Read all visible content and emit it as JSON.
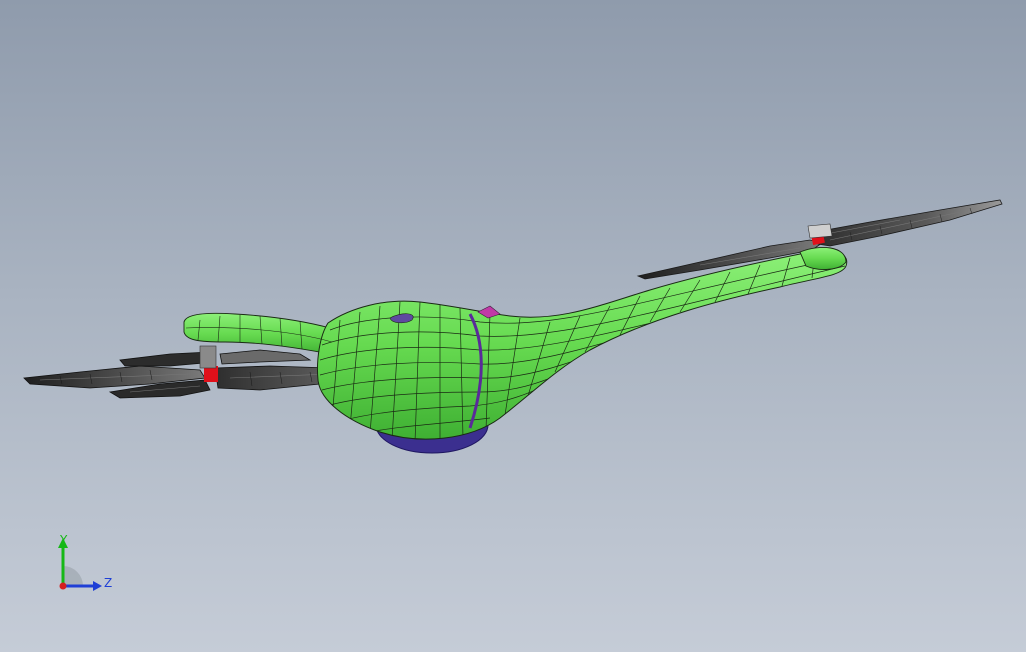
{
  "viewport": {
    "background_top": "#8f9bac",
    "background_bottom": "#c5ccd7"
  },
  "model": {
    "body_color": "#6fe35a",
    "mesh_line_color": "#1a2a14",
    "belly_color": "#3b2f8f",
    "propeller_color": "#3a3a3a",
    "motor_accent_color": "#e0101a"
  },
  "triad": {
    "y_label": "Y",
    "z_label": "Z",
    "y_color": "#16b816",
    "z_color": "#1f3fd6",
    "x_color": "#d42020"
  }
}
